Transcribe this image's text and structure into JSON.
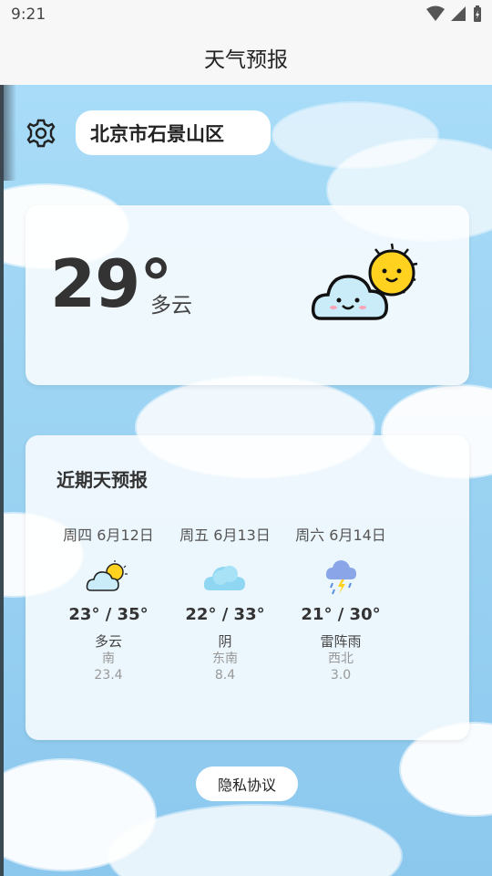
{
  "status": {
    "time": "9:21"
  },
  "app": {
    "title": "天气预报"
  },
  "location": "北京市石景山区",
  "current": {
    "temp": "29°",
    "condition": "多云",
    "icon": "sun-behind-cloud-icon"
  },
  "forecast": {
    "title": "近期天预报",
    "days": [
      {
        "date": "周四 6月12日",
        "range": "23° / 35°",
        "condition": "多云",
        "wind": "南",
        "speed": "23.4",
        "icon": "sun-behind-cloud-icon"
      },
      {
        "date": "周五 6月13日",
        "range": "22° / 33°",
        "condition": "阴",
        "wind": "东南",
        "speed": "8.4",
        "icon": "cloud-icon"
      },
      {
        "date": "周六 6月14日",
        "range": "21° / 30°",
        "condition": "雷阵雨",
        "wind": "西北",
        "speed": "3.0",
        "icon": "thunder-rain-icon"
      }
    ]
  },
  "privacy_label": "隐私协议",
  "colors": {
    "sky": "#9dd4f3",
    "sun": "#ffd21f",
    "cloud": "#c9ecf8"
  }
}
